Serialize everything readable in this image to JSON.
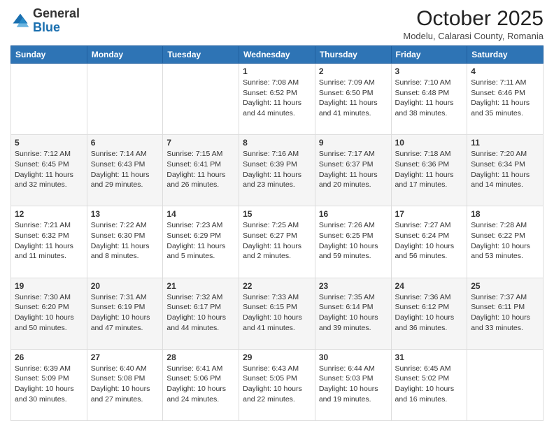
{
  "header": {
    "logo_general": "General",
    "logo_blue": "Blue",
    "month_year": "October 2025",
    "location": "Modelu, Calarasi County, Romania"
  },
  "weekdays": [
    "Sunday",
    "Monday",
    "Tuesday",
    "Wednesday",
    "Thursday",
    "Friday",
    "Saturday"
  ],
  "weeks": [
    [
      {
        "day": "",
        "info": ""
      },
      {
        "day": "",
        "info": ""
      },
      {
        "day": "",
        "info": ""
      },
      {
        "day": "1",
        "info": "Sunrise: 7:08 AM\nSunset: 6:52 PM\nDaylight: 11 hours and 44 minutes."
      },
      {
        "day": "2",
        "info": "Sunrise: 7:09 AM\nSunset: 6:50 PM\nDaylight: 11 hours and 41 minutes."
      },
      {
        "day": "3",
        "info": "Sunrise: 7:10 AM\nSunset: 6:48 PM\nDaylight: 11 hours and 38 minutes."
      },
      {
        "day": "4",
        "info": "Sunrise: 7:11 AM\nSunset: 6:46 PM\nDaylight: 11 hours and 35 minutes."
      }
    ],
    [
      {
        "day": "5",
        "info": "Sunrise: 7:12 AM\nSunset: 6:45 PM\nDaylight: 11 hours and 32 minutes."
      },
      {
        "day": "6",
        "info": "Sunrise: 7:14 AM\nSunset: 6:43 PM\nDaylight: 11 hours and 29 minutes."
      },
      {
        "day": "7",
        "info": "Sunrise: 7:15 AM\nSunset: 6:41 PM\nDaylight: 11 hours and 26 minutes."
      },
      {
        "day": "8",
        "info": "Sunrise: 7:16 AM\nSunset: 6:39 PM\nDaylight: 11 hours and 23 minutes."
      },
      {
        "day": "9",
        "info": "Sunrise: 7:17 AM\nSunset: 6:37 PM\nDaylight: 11 hours and 20 minutes."
      },
      {
        "day": "10",
        "info": "Sunrise: 7:18 AM\nSunset: 6:36 PM\nDaylight: 11 hours and 17 minutes."
      },
      {
        "day": "11",
        "info": "Sunrise: 7:20 AM\nSunset: 6:34 PM\nDaylight: 11 hours and 14 minutes."
      }
    ],
    [
      {
        "day": "12",
        "info": "Sunrise: 7:21 AM\nSunset: 6:32 PM\nDaylight: 11 hours and 11 minutes."
      },
      {
        "day": "13",
        "info": "Sunrise: 7:22 AM\nSunset: 6:30 PM\nDaylight: 11 hours and 8 minutes."
      },
      {
        "day": "14",
        "info": "Sunrise: 7:23 AM\nSunset: 6:29 PM\nDaylight: 11 hours and 5 minutes."
      },
      {
        "day": "15",
        "info": "Sunrise: 7:25 AM\nSunset: 6:27 PM\nDaylight: 11 hours and 2 minutes."
      },
      {
        "day": "16",
        "info": "Sunrise: 7:26 AM\nSunset: 6:25 PM\nDaylight: 10 hours and 59 minutes."
      },
      {
        "day": "17",
        "info": "Sunrise: 7:27 AM\nSunset: 6:24 PM\nDaylight: 10 hours and 56 minutes."
      },
      {
        "day": "18",
        "info": "Sunrise: 7:28 AM\nSunset: 6:22 PM\nDaylight: 10 hours and 53 minutes."
      }
    ],
    [
      {
        "day": "19",
        "info": "Sunrise: 7:30 AM\nSunset: 6:20 PM\nDaylight: 10 hours and 50 minutes."
      },
      {
        "day": "20",
        "info": "Sunrise: 7:31 AM\nSunset: 6:19 PM\nDaylight: 10 hours and 47 minutes."
      },
      {
        "day": "21",
        "info": "Sunrise: 7:32 AM\nSunset: 6:17 PM\nDaylight: 10 hours and 44 minutes."
      },
      {
        "day": "22",
        "info": "Sunrise: 7:33 AM\nSunset: 6:15 PM\nDaylight: 10 hours and 41 minutes."
      },
      {
        "day": "23",
        "info": "Sunrise: 7:35 AM\nSunset: 6:14 PM\nDaylight: 10 hours and 39 minutes."
      },
      {
        "day": "24",
        "info": "Sunrise: 7:36 AM\nSunset: 6:12 PM\nDaylight: 10 hours and 36 minutes."
      },
      {
        "day": "25",
        "info": "Sunrise: 7:37 AM\nSunset: 6:11 PM\nDaylight: 10 hours and 33 minutes."
      }
    ],
    [
      {
        "day": "26",
        "info": "Sunrise: 6:39 AM\nSunset: 5:09 PM\nDaylight: 10 hours and 30 minutes."
      },
      {
        "day": "27",
        "info": "Sunrise: 6:40 AM\nSunset: 5:08 PM\nDaylight: 10 hours and 27 minutes."
      },
      {
        "day": "28",
        "info": "Sunrise: 6:41 AM\nSunset: 5:06 PM\nDaylight: 10 hours and 24 minutes."
      },
      {
        "day": "29",
        "info": "Sunrise: 6:43 AM\nSunset: 5:05 PM\nDaylight: 10 hours and 22 minutes."
      },
      {
        "day": "30",
        "info": "Sunrise: 6:44 AM\nSunset: 5:03 PM\nDaylight: 10 hours and 19 minutes."
      },
      {
        "day": "31",
        "info": "Sunrise: 6:45 AM\nSunset: 5:02 PM\nDaylight: 10 hours and 16 minutes."
      },
      {
        "day": "",
        "info": ""
      }
    ]
  ]
}
